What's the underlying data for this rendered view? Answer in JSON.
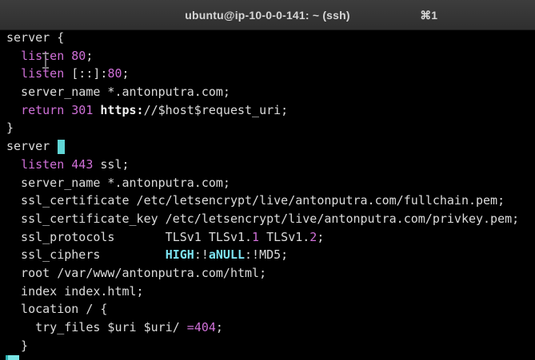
{
  "window": {
    "title": "ubuntu@ip-10-0-0-141: ~ (ssh)",
    "shortcut": "⌘1"
  },
  "config": {
    "l01": "server {",
    "l02_indent": "  ",
    "l02_kw": "listen",
    "l02_num": "80",
    "l02_end": ";",
    "l03_kw": "listen",
    "l03_mid": " [::]:",
    "l03_num": "80",
    "l03_end": ";",
    "l04": "  server_name *.antonputra.com;",
    "l05_kw": "return",
    "l05_num": "301",
    "l05_url": "https:",
    "l05_rest": "//$host$request_uri;",
    "l06": "}",
    "l07": "server ",
    "l08_kw": "listen",
    "l08_num": "443",
    "l08_end": " ssl;",
    "l09": "  server_name *.antonputra.com;",
    "l10": "  ssl_certificate /etc/letsencrypt/live/antonputra.com/fullchain.pem;",
    "l11": "  ssl_certificate_key /etc/letsencrypt/live/antonputra.com/privkey.pem;",
    "l12_a": "  ssl_protocols       TLSv1 TLSv1.",
    "l12_n1": "1",
    "l12_b": " TLSv1.",
    "l12_n2": "2",
    "l12_end": ";",
    "l13_a": "  ssl_ciphers         ",
    "l13_c1": "HIGH",
    "l13_s1": ":!",
    "l13_c2": "aNULL",
    "l13_s2": ":!MD5;",
    "l14": "  root /var/www/antonputra.com/html;",
    "l15": "  index index.html;",
    "l16": "  location / {",
    "l17_a": "    try_files $uri $uri/ ",
    "l17_eq": "=",
    "l17_num": "404",
    "l17_end": ";",
    "l18": "  }"
  },
  "colors": {
    "background": "#000000",
    "text": "#dcdcdc",
    "keyword": "#d070d8",
    "cursor": "#7ae6e6"
  }
}
